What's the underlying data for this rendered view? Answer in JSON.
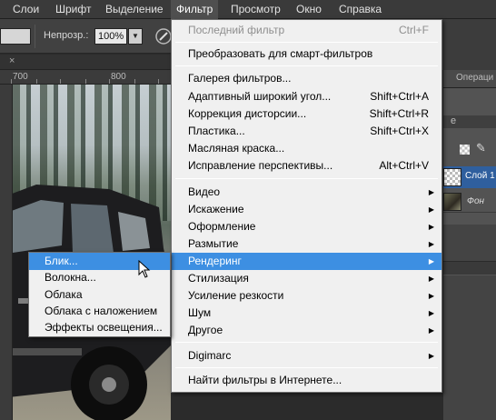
{
  "menubar": {
    "items": [
      "Слои",
      "Шрифт",
      "Выделение",
      "Фильтр",
      "Просмотр",
      "Окно",
      "Справка"
    ],
    "active": "Фильтр"
  },
  "options": {
    "opacity_label": "Непрозр.:",
    "opacity_value": "100%"
  },
  "ruler": {
    "numbers": [
      "700",
      "800"
    ]
  },
  "right_panel": {
    "top_tab": "Операци",
    "header_tab": "е",
    "layers": [
      {
        "name": "Слой 1",
        "selected": true
      },
      {
        "name": "Фон",
        "selected": false
      }
    ]
  },
  "filter_menu": {
    "items": [
      {
        "label": "Последний фильтр",
        "shortcut": "Ctrl+F",
        "disabled": true,
        "submenu": false
      },
      {
        "label": "Преобразовать для смарт-фильтров",
        "shortcut": "",
        "disabled": false,
        "submenu": false
      },
      {
        "label": "Галерея фильтров...",
        "shortcut": "",
        "disabled": false,
        "submenu": false
      },
      {
        "label": "Адаптивный широкий угол...",
        "shortcut": "Shift+Ctrl+A",
        "disabled": false,
        "submenu": false
      },
      {
        "label": "Коррекция дисторсии...",
        "shortcut": "Shift+Ctrl+R",
        "disabled": false,
        "submenu": false
      },
      {
        "label": "Пластика...",
        "shortcut": "Shift+Ctrl+X",
        "disabled": false,
        "submenu": false
      },
      {
        "label": "Масляная краска...",
        "shortcut": "",
        "disabled": false,
        "submenu": false
      },
      {
        "label": "Исправление перспективы...",
        "shortcut": "Alt+Ctrl+V",
        "disabled": false,
        "submenu": false
      },
      {
        "label": "Видео",
        "shortcut": "",
        "disabled": false,
        "submenu": true
      },
      {
        "label": "Искажение",
        "shortcut": "",
        "disabled": false,
        "submenu": true
      },
      {
        "label": "Оформление",
        "shortcut": "",
        "disabled": false,
        "submenu": true
      },
      {
        "label": "Размытие",
        "shortcut": "",
        "disabled": false,
        "submenu": true
      },
      {
        "label": "Рендеринг",
        "shortcut": "",
        "disabled": false,
        "submenu": true,
        "highlighted": true
      },
      {
        "label": "Стилизация",
        "shortcut": "",
        "disabled": false,
        "submenu": true
      },
      {
        "label": "Усиление резкости",
        "shortcut": "",
        "disabled": false,
        "submenu": true
      },
      {
        "label": "Шум",
        "shortcut": "",
        "disabled": false,
        "submenu": true
      },
      {
        "label": "Другое",
        "shortcut": "",
        "disabled": false,
        "submenu": true
      },
      {
        "label": "Digimarc",
        "shortcut": "",
        "disabled": false,
        "submenu": true
      },
      {
        "label": "Найти фильтры в Интернете...",
        "shortcut": "",
        "disabled": false,
        "submenu": false
      }
    ]
  },
  "render_submenu": {
    "items": [
      {
        "label": "Блик...",
        "highlighted": true
      },
      {
        "label": "Волокна...",
        "highlighted": false
      },
      {
        "label": "Облака",
        "highlighted": false
      },
      {
        "label": "Облака с наложением",
        "highlighted": false
      },
      {
        "label": "Эффекты освещения...",
        "highlighted": false
      }
    ]
  },
  "colors": {
    "highlight": "#3d8fe2",
    "menu_bg": "#f0f0f0",
    "app_bg": "#3a3a3a",
    "selected_layer": "#2f5f9e"
  }
}
